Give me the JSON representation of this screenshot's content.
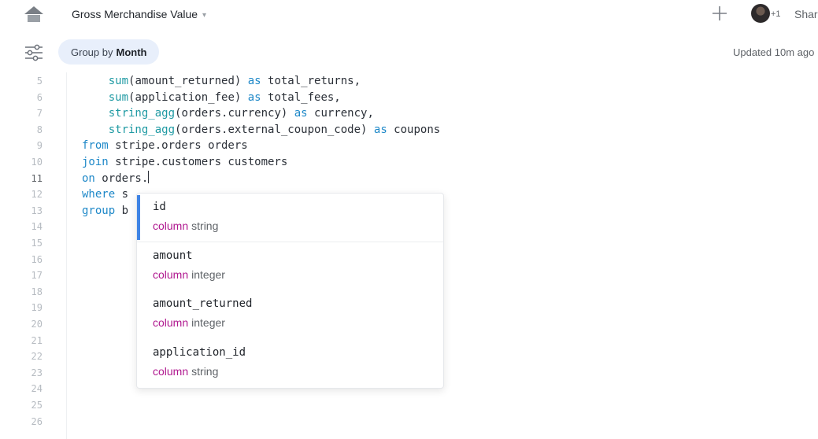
{
  "header": {
    "title": "Gross Merchandise Value",
    "caret": "▾",
    "collaborator_count": "+1",
    "share_label": "Share"
  },
  "toolbar": {
    "group_prefix": "Group by",
    "group_value": "Month",
    "updated": "Updated 10m ago"
  },
  "editor": {
    "active_line": "11",
    "lines": [
      {
        "n": "5",
        "tokens": [
          [
            "    ",
            ""
          ],
          [
            "sum",
            "fn"
          ],
          [
            "(amount_returned) ",
            ""
          ],
          [
            "as",
            "kw"
          ],
          [
            " total_returns,",
            ""
          ]
        ]
      },
      {
        "n": "6",
        "tokens": [
          [
            "    ",
            ""
          ],
          [
            "sum",
            "fn"
          ],
          [
            "(application_fee) ",
            ""
          ],
          [
            "as",
            "kw"
          ],
          [
            " total_fees,",
            ""
          ]
        ]
      },
      {
        "n": "7",
        "tokens": [
          [
            "    ",
            ""
          ],
          [
            "string_agg",
            "fn"
          ],
          [
            "(orders.currency) ",
            ""
          ],
          [
            "as",
            "kw"
          ],
          [
            " currency,",
            ""
          ]
        ]
      },
      {
        "n": "8",
        "tokens": [
          [
            "    ",
            ""
          ],
          [
            "string_agg",
            "fn"
          ],
          [
            "(orders.external_coupon_code) ",
            ""
          ],
          [
            "as",
            "kw"
          ],
          [
            " coupons",
            ""
          ]
        ]
      },
      {
        "n": "9",
        "tokens": [
          [
            "from",
            "kw"
          ],
          [
            " stripe.orders orders",
            ""
          ]
        ]
      },
      {
        "n": "10",
        "tokens": [
          [
            "join",
            "kw"
          ],
          [
            " stripe.customers customers",
            ""
          ]
        ]
      },
      {
        "n": "11",
        "tokens": [
          [
            "on",
            "kw"
          ],
          [
            " orders.",
            ""
          ]
        ],
        "cursor": true
      },
      {
        "n": "12",
        "tokens": [
          [
            "where",
            "kw"
          ],
          [
            " s",
            ""
          ]
        ]
      },
      {
        "n": "13",
        "tokens": [
          [
            "group",
            "kw"
          ],
          [
            " b",
            ""
          ]
        ]
      },
      {
        "n": "14",
        "tokens": []
      },
      {
        "n": "15",
        "tokens": []
      },
      {
        "n": "16",
        "tokens": []
      },
      {
        "n": "17",
        "tokens": []
      },
      {
        "n": "18",
        "tokens": []
      },
      {
        "n": "19",
        "tokens": []
      },
      {
        "n": "20",
        "tokens": []
      },
      {
        "n": "21",
        "tokens": []
      },
      {
        "n": "22",
        "tokens": []
      },
      {
        "n": "23",
        "tokens": []
      },
      {
        "n": "24",
        "tokens": []
      },
      {
        "n": "25",
        "tokens": []
      },
      {
        "n": "26",
        "tokens": []
      }
    ]
  },
  "autocomplete": {
    "selected_index": 0,
    "items": [
      {
        "name": "id",
        "kind": "column",
        "type": "string"
      },
      {
        "name": "amount",
        "kind": "column",
        "type": "integer"
      },
      {
        "name": "amount_returned",
        "kind": "column",
        "type": "integer"
      },
      {
        "name": "application_id",
        "kind": "column",
        "type": "string"
      }
    ]
  },
  "colors": {
    "keyword": "#1e88c8",
    "function": "#1f9aa3",
    "column_kind": "#b0188f",
    "selection_bar": "#3f84e5",
    "pill_bg": "#e8effb"
  },
  "icons": [
    "home-icon",
    "plus-icon",
    "filter-sliders-icon",
    "avatar"
  ]
}
